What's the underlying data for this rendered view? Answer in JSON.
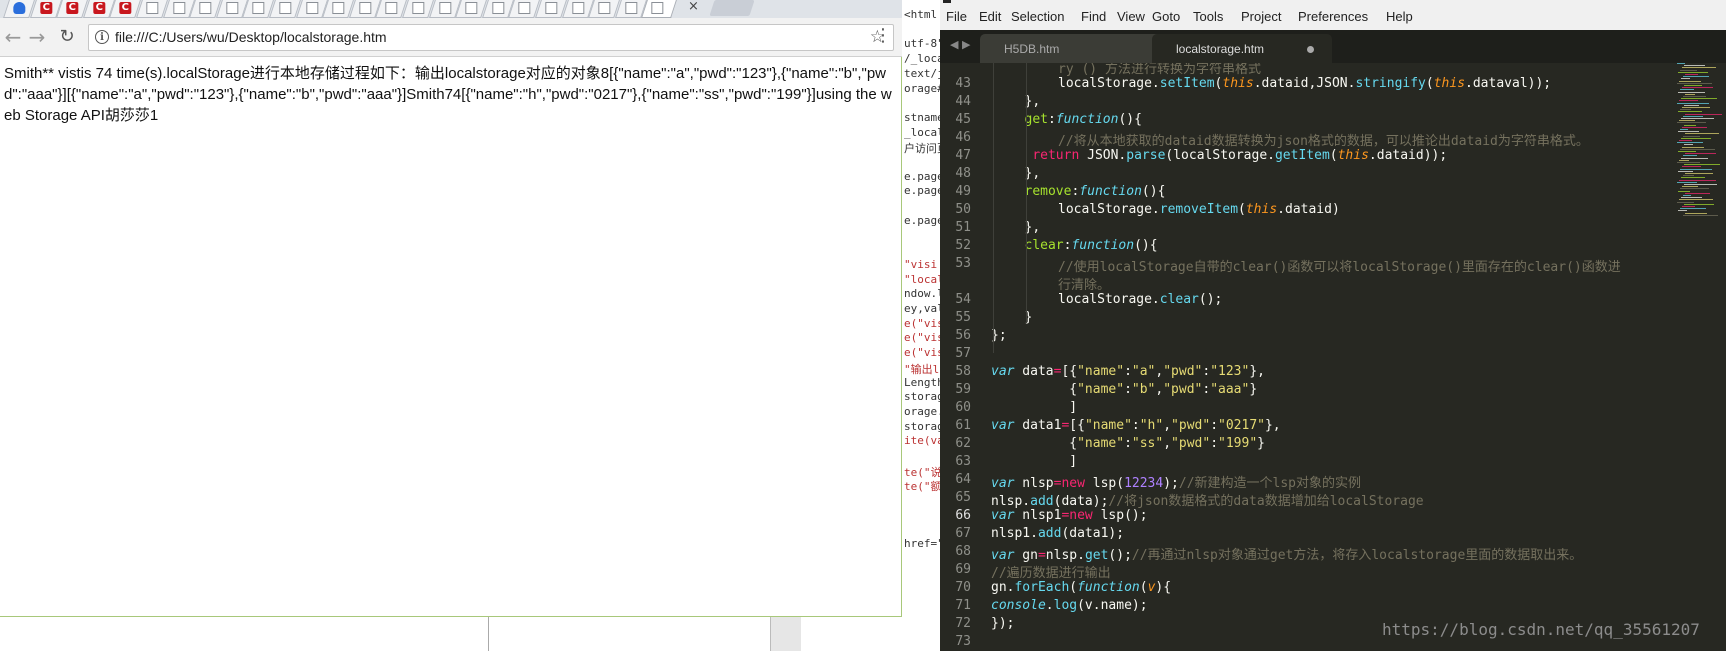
{
  "browser": {
    "tabs": [
      {
        "icon": "baidu-paw-icon"
      },
      {
        "icon": "csdn-icon",
        "letter": "C"
      },
      {
        "icon": "csdn-icon",
        "letter": "C"
      },
      {
        "icon": "csdn-icon",
        "letter": "C"
      },
      {
        "icon": "csdn-icon",
        "letter": "C"
      },
      {
        "icon": "page-icon"
      },
      {
        "icon": "page-icon"
      },
      {
        "icon": "page-icon"
      },
      {
        "icon": "page-icon"
      },
      {
        "icon": "page-icon"
      },
      {
        "icon": "page-icon"
      },
      {
        "icon": "page-icon"
      },
      {
        "icon": "page-icon"
      },
      {
        "icon": "page-icon"
      },
      {
        "icon": "page-icon"
      },
      {
        "icon": "page-icon"
      },
      {
        "icon": "page-icon"
      },
      {
        "icon": "page-icon"
      },
      {
        "icon": "page-icon"
      },
      {
        "icon": "page-icon"
      },
      {
        "icon": "page-icon"
      },
      {
        "icon": "page-icon"
      },
      {
        "icon": "page-icon"
      },
      {
        "icon": "page-icon"
      },
      {
        "icon": "page-icon",
        "active": true
      }
    ],
    "tab_close": "×",
    "back": "←",
    "forward": "→",
    "reload": "↻",
    "url": "file:///C:/Users/wu/Desktop/localstorage.htm",
    "info": "i",
    "star": "☆",
    "menu": "⋮",
    "content_text": "Smith** vistis 74 time(s).localStorage进行本地存储过程如下：输出localstorage对应的对象8[{\"name\":\"a\",\"pwd\":\"123\"},{\"name\":\"b\",\"pwd\":\"aaa\"}][{\"name\":\"a\",\"pwd\":\"123\"},{\"name\":\"b\",\"pwd\":\"aaa\"}]Smith74[{\"name\":\"h\",\"pwd\":\"0217\"},{\"name\":\"ss\",\"pwd\":\"199\"}]using the web Storage API胡莎莎1"
  },
  "background_strip": [
    "<html",
    "",
    "utf-8\"",
    "/_local",
    "text/ja",
    "orage#",
    "",
    "stname",
    "_locals",
    "户访问页",
    "",
    "e.pagee",
    "e.page",
    "",
    "e.page",
    "",
    "",
    "\"visi",
    "\"local",
    "ndow.lo",
    "ey,val",
    "e(\"vis",
    "e(\"vis",
    "e(\"vis",
    "\"输出l",
    "Length",
    "storage",
    "orage.k",
    "storage",
    "ite(va",
    "",
    "te(\"说",
    "te(\"额",
    "",
    "",
    "",
    "href=\""
  ],
  "editor": {
    "menu": [
      "File",
      "Edit",
      "Selection",
      "Find",
      "View",
      "Goto",
      "Tools",
      "Project",
      "Preferences",
      "Help"
    ],
    "tabs": [
      {
        "label": "H5DB.htm",
        "close": "×"
      },
      {
        "label": "localstorage.htm",
        "modified": true
      }
    ],
    "nav_arrows": "◀ ▶",
    "current_line": 66,
    "watermark": "https://blog.csdn.net/qq_35561207",
    "lines": [
      {
        "n": "",
        "indent": 2,
        "tokens": [
          [
            "c",
            "ry () 方法进行转换为字符串格式"
          ]
        ]
      },
      {
        "n": "43",
        "indent": 2,
        "tokens": [
          [
            "",
            "localStorage."
          ],
          [
            "f",
            "setItem"
          ],
          [
            "",
            "("
          ],
          [
            "t",
            "this"
          ],
          [
            "",
            ".dataid,JSON."
          ],
          [
            "f",
            "stringify"
          ],
          [
            "",
            "("
          ],
          [
            "t",
            "this"
          ],
          [
            "",
            ".dataval));"
          ]
        ]
      },
      {
        "n": "44",
        "indent": 1,
        "tokens": [
          [
            "",
            "},"
          ]
        ]
      },
      {
        "n": "45",
        "indent": 1,
        "tokens": [
          [
            "prop",
            "get"
          ],
          [
            "",
            ":"
          ],
          [
            "k",
            "function"
          ],
          [
            "",
            "(){"
          ]
        ]
      },
      {
        "n": "46",
        "indent": 2,
        "tokens": [
          [
            "c",
            "//将从本地获取的dataid数据转换为json格式的数据，可以推论出dataid为字符串格式。"
          ]
        ]
      },
      {
        "n": "47",
        "indent": 1,
        "pad": " ",
        "tokens": [
          [
            "o",
            "return"
          ],
          [
            "",
            " JSON."
          ],
          [
            "f",
            "parse"
          ],
          [
            "",
            "(localStorage."
          ],
          [
            "f",
            "getItem"
          ],
          [
            "",
            "("
          ],
          [
            "t",
            "this"
          ],
          [
            "",
            ".dataid));"
          ]
        ]
      },
      {
        "n": "48",
        "indent": 1,
        "tokens": [
          [
            "",
            "},"
          ]
        ]
      },
      {
        "n": "49",
        "indent": 1,
        "tokens": [
          [
            "prop",
            "remove"
          ],
          [
            "",
            ":"
          ],
          [
            "k",
            "function"
          ],
          [
            "",
            "(){"
          ]
        ]
      },
      {
        "n": "50",
        "indent": 2,
        "tokens": [
          [
            "",
            "localStorage."
          ],
          [
            "f",
            "removeItem"
          ],
          [
            "",
            "("
          ],
          [
            "t",
            "this"
          ],
          [
            "",
            ".dataid)"
          ]
        ]
      },
      {
        "n": "51",
        "indent": 1,
        "tokens": [
          [
            "",
            "},"
          ]
        ]
      },
      {
        "n": "52",
        "indent": 1,
        "tokens": [
          [
            "prop",
            "clear"
          ],
          [
            "",
            ":"
          ],
          [
            "k",
            "function"
          ],
          [
            "",
            "(){"
          ]
        ]
      },
      {
        "n": "53",
        "indent": 2,
        "tokens": [
          [
            "c",
            "//使用localStorage自带的clear()函数可以将localStorage()里面存在的clear()函数进"
          ]
        ]
      },
      {
        "n": "",
        "indent": 2,
        "tokens": [
          [
            "c",
            "行清除。"
          ]
        ]
      },
      {
        "n": "54",
        "indent": 2,
        "tokens": [
          [
            "",
            "localStorage."
          ],
          [
            "f",
            "clear"
          ],
          [
            "",
            "();"
          ]
        ]
      },
      {
        "n": "55",
        "indent": 1,
        "tokens": [
          [
            "",
            "}"
          ]
        ]
      },
      {
        "n": "56",
        "indent": 0,
        "tokens": [
          [
            "",
            "};"
          ]
        ]
      },
      {
        "n": "57",
        "indent": 0,
        "tokens": []
      },
      {
        "n": "58",
        "indent": 0,
        "tokens": [
          [
            "k",
            "var"
          ],
          [
            "",
            " data"
          ],
          [
            "o",
            "="
          ],
          [
            "",
            "[{"
          ],
          [
            "s",
            "\"name\""
          ],
          [
            "",
            ":"
          ],
          [
            "s",
            "\"a\""
          ],
          [
            "",
            ","
          ],
          [
            "s",
            "\"pwd\""
          ],
          [
            "",
            ":"
          ],
          [
            "s",
            "\"123\""
          ],
          [
            "",
            "},"
          ]
        ]
      },
      {
        "n": "59",
        "indent": 0,
        "pad": "          ",
        "tokens": [
          [
            "",
            "{"
          ],
          [
            "s",
            "\"name\""
          ],
          [
            "",
            ":"
          ],
          [
            "s",
            "\"b\""
          ],
          [
            "",
            ","
          ],
          [
            "s",
            "\"pwd\""
          ],
          [
            "",
            ":"
          ],
          [
            "s",
            "\"aaa\""
          ],
          [
            "",
            "}"
          ]
        ]
      },
      {
        "n": "60",
        "indent": 0,
        "pad": "          ",
        "tokens": [
          [
            "",
            "]"
          ]
        ]
      },
      {
        "n": "61",
        "indent": 0,
        "tokens": [
          [
            "k",
            "var"
          ],
          [
            "",
            " data1"
          ],
          [
            "o",
            "="
          ],
          [
            "",
            "[{"
          ],
          [
            "s",
            "\"name\""
          ],
          [
            "",
            ":"
          ],
          [
            "s",
            "\"h\""
          ],
          [
            "",
            ","
          ],
          [
            "s",
            "\"pwd\""
          ],
          [
            "",
            ":"
          ],
          [
            "s",
            "\"0217\""
          ],
          [
            "",
            "},"
          ]
        ]
      },
      {
        "n": "62",
        "indent": 0,
        "pad": "          ",
        "tokens": [
          [
            "",
            "{"
          ],
          [
            "s",
            "\"name\""
          ],
          [
            "",
            ":"
          ],
          [
            "s",
            "\"ss\""
          ],
          [
            "",
            ","
          ],
          [
            "s",
            "\"pwd\""
          ],
          [
            "",
            ":"
          ],
          [
            "s",
            "\"199\""
          ],
          [
            "",
            "}"
          ]
        ]
      },
      {
        "n": "63",
        "indent": 0,
        "pad": "          ",
        "tokens": [
          [
            "",
            "]"
          ]
        ]
      },
      {
        "n": "64",
        "indent": 0,
        "tokens": [
          [
            "k",
            "var"
          ],
          [
            "",
            " nlsp"
          ],
          [
            "o",
            "="
          ],
          [
            "o",
            "new"
          ],
          [
            "",
            " lsp("
          ],
          [
            "n",
            "12234"
          ],
          [
            "",
            ");"
          ],
          [
            "c",
            "//新建构造一个lsp对象的实例"
          ]
        ]
      },
      {
        "n": "65",
        "indent": 0,
        "tokens": [
          [
            "",
            "nlsp."
          ],
          [
            "f",
            "add"
          ],
          [
            "",
            "(data);"
          ],
          [
            "c",
            "//将json数据格式的data数据增加给localStorage"
          ]
        ]
      },
      {
        "n": "66",
        "indent": 0,
        "tokens": [
          [
            "k",
            "var"
          ],
          [
            "",
            " nlsp1"
          ],
          [
            "o",
            "="
          ],
          [
            "o",
            "new"
          ],
          [
            "",
            " lsp();"
          ]
        ]
      },
      {
        "n": "67",
        "indent": 0,
        "tokens": [
          [
            "",
            "nlsp1."
          ],
          [
            "f",
            "add"
          ],
          [
            "",
            "(data1);"
          ]
        ]
      },
      {
        "n": "68",
        "indent": 0,
        "tokens": [
          [
            "k",
            "var"
          ],
          [
            "",
            " gn"
          ],
          [
            "o",
            "="
          ],
          [
            "",
            "nlsp."
          ],
          [
            "f",
            "get"
          ],
          [
            "",
            "();"
          ],
          [
            "c",
            "//再通过nlsp对象通过get方法，将存入localstorage里面的数据取出来。"
          ]
        ]
      },
      {
        "n": "69",
        "indent": 0,
        "tokens": [
          [
            "c",
            "//遍历数据进行输出"
          ]
        ]
      },
      {
        "n": "70",
        "indent": 0,
        "tokens": [
          [
            "",
            "gn."
          ],
          [
            "f",
            "forEach"
          ],
          [
            "",
            "("
          ],
          [
            "k",
            "function"
          ],
          [
            "",
            "("
          ],
          [
            "t",
            "v"
          ],
          [
            "",
            "){"
          ]
        ]
      },
      {
        "n": "71",
        "indent": 0,
        "tokens": [
          [
            "k",
            "console"
          ],
          [
            "",
            "."
          ],
          [
            "f",
            "log"
          ],
          [
            "",
            "(v.name);"
          ]
        ]
      },
      {
        "n": "72",
        "indent": 0,
        "tokens": [
          [
            "",
            "});"
          ]
        ]
      },
      {
        "n": "73",
        "indent": 0,
        "tokens": []
      }
    ]
  }
}
